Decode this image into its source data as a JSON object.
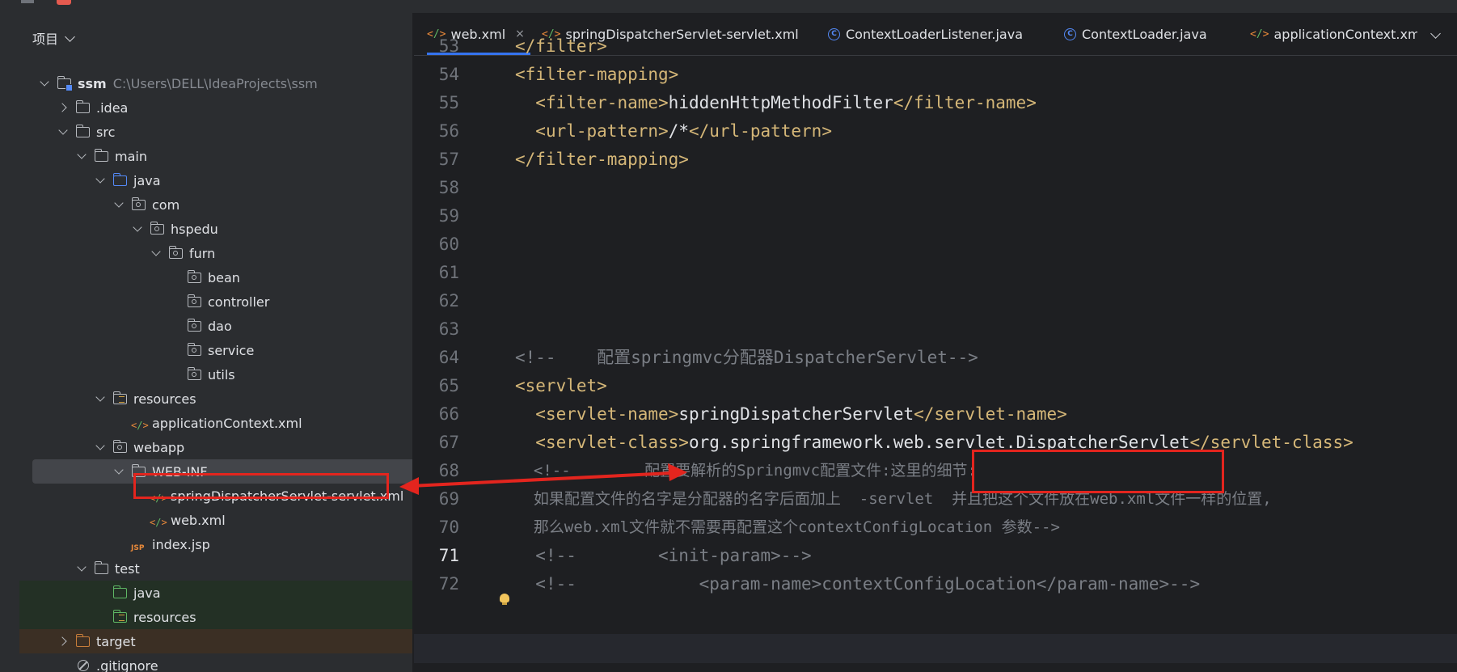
{
  "panel": {
    "title": "项目"
  },
  "tree": [
    {
      "label": "ssm",
      "path": "C:\\Users\\DELL\\IdeaProjects\\ssm",
      "indent": 0,
      "arrow": "down",
      "icon": "module-folder"
    },
    {
      "label": ".idea",
      "indent": 1,
      "arrow": "right",
      "icon": "folder"
    },
    {
      "label": "src",
      "indent": 1,
      "arrow": "down",
      "icon": "folder"
    },
    {
      "label": "main",
      "indent": 2,
      "arrow": "down",
      "icon": "folder"
    },
    {
      "label": "java",
      "indent": 3,
      "arrow": "down",
      "icon": "source-folder"
    },
    {
      "label": "com",
      "indent": 4,
      "arrow": "down",
      "icon": "package"
    },
    {
      "label": "hspedu",
      "indent": 5,
      "arrow": "down",
      "icon": "package"
    },
    {
      "label": "furn",
      "indent": 6,
      "arrow": "down",
      "icon": "package"
    },
    {
      "label": "bean",
      "indent": 7,
      "arrow": "none",
      "icon": "package"
    },
    {
      "label": "controller",
      "indent": 7,
      "arrow": "none",
      "icon": "package"
    },
    {
      "label": "dao",
      "indent": 7,
      "arrow": "none",
      "icon": "package"
    },
    {
      "label": "service",
      "indent": 7,
      "arrow": "none",
      "icon": "package"
    },
    {
      "label": "utils",
      "indent": 7,
      "arrow": "none",
      "icon": "package"
    },
    {
      "label": "resources",
      "indent": 3,
      "arrow": "down",
      "icon": "resources-folder"
    },
    {
      "label": "applicationContext.xml",
      "indent": 4,
      "arrow": "none",
      "icon": "xml-file"
    },
    {
      "label": "webapp",
      "indent": 3,
      "arrow": "down",
      "icon": "web-folder"
    },
    {
      "label": "WEB-INF",
      "indent": 4,
      "arrow": "down",
      "icon": "folder",
      "selected": true
    },
    {
      "label": "springDispatcherServlet-servlet.xml",
      "indent": 5,
      "arrow": "none",
      "icon": "xml-file",
      "highlighted": true
    },
    {
      "label": "web.xml",
      "indent": 5,
      "arrow": "none",
      "icon": "web-xml-file"
    },
    {
      "label": "index.jsp",
      "indent": 4,
      "arrow": "none",
      "icon": "jsp-file"
    },
    {
      "label": "test",
      "indent": 2,
      "arrow": "down",
      "icon": "folder"
    },
    {
      "label": "java",
      "indent": 3,
      "arrow": "none",
      "icon": "test-folder",
      "bg": "green"
    },
    {
      "label": "resources",
      "indent": 3,
      "arrow": "none",
      "icon": "test-resources-folder",
      "bg": "green"
    },
    {
      "label": "target",
      "indent": 1,
      "arrow": "right",
      "icon": "excluded-folder",
      "bg": "brown"
    },
    {
      "label": ".gitignore",
      "indent": 1,
      "arrow": "none",
      "icon": "ignore-file"
    }
  ],
  "tabs": [
    {
      "label": "web.xml",
      "icon": "xml",
      "active": true,
      "closable": true
    },
    {
      "label": "springDispatcherServlet-servlet.xml",
      "icon": "xml"
    },
    {
      "label": "ContextLoaderListener.java",
      "icon": "class"
    },
    {
      "label": "ContextLoader.java",
      "icon": "class"
    },
    {
      "label": "applicationContext.xml",
      "icon": "xml"
    }
  ],
  "editor": {
    "lines": [
      {
        "n": "53",
        "code": "</filter>"
      },
      {
        "n": "54",
        "code": "<filter-mapping>"
      },
      {
        "n": "55",
        "code": "  <filter-name>hiddenHttpMethodFilter</filter-name>"
      },
      {
        "n": "56",
        "code": "  <url-pattern>/*</url-pattern>"
      },
      {
        "n": "57",
        "code": "</filter-mapping>"
      },
      {
        "n": "58",
        "code": ""
      },
      {
        "n": "59",
        "code": ""
      },
      {
        "n": "60",
        "code": ""
      },
      {
        "n": "61",
        "code": ""
      },
      {
        "n": "62",
        "code": ""
      },
      {
        "n": "63",
        "code": ""
      },
      {
        "n": "64",
        "code": "<!--    配置springmvc分配器DispatcherServlet-->"
      },
      {
        "n": "65",
        "code": "<servlet>"
      },
      {
        "n": "66",
        "code": "  <servlet-name>springDispatcherServlet</servlet-name>"
      },
      {
        "n": "67",
        "code": "  <servlet-class>org.springframework.web.servlet.DispatcherServlet</servlet-class>"
      },
      {
        "n": "68",
        "code": "  <!--        配置要解析的Springmvc配置文件:这里的细节:"
      },
      {
        "n": "69",
        "code": "  如果配置文件的名字是分配器的名字后面加上  -servlet  并且把这个文件放在web.xml文件一样的位置,"
      },
      {
        "n": "70",
        "code": "  那么web.xml文件就不需要再配置这个contextConfigLocation 参数-->"
      },
      {
        "n": "71",
        "code": "  <!--        <init-param>-->"
      },
      {
        "n": "72",
        "code": "  <!--            <param-name>contextConfigLocation</param-name>-->"
      }
    ],
    "current_line": "71"
  }
}
